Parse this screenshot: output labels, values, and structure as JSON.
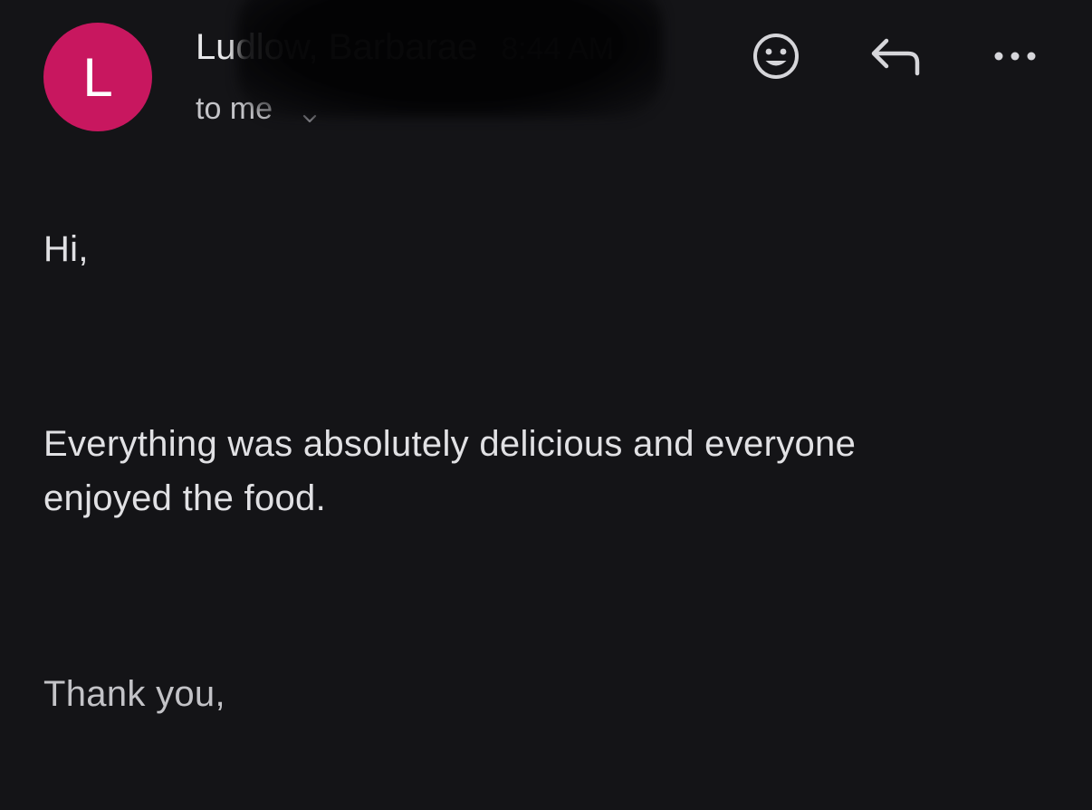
{
  "sender": {
    "avatar_letter": "L",
    "avatar_color": "#c8175f",
    "name": "Ludlow, Barbarae",
    "time": "8:44 AM",
    "recipient": "to me"
  },
  "actions": {
    "emoji_icon": "smiley-face-icon",
    "reply_icon": "reply-arrow-icon",
    "more_icon": "more-horizontal-icon"
  },
  "message": {
    "greeting": "Hi,",
    "body_line1": "Everything was absolutely delicious and everyone",
    "body_line2": "enjoyed the food.",
    "closing": "Thank you,"
  },
  "colors": {
    "background": "#141417",
    "text": "#e1e1e4"
  }
}
